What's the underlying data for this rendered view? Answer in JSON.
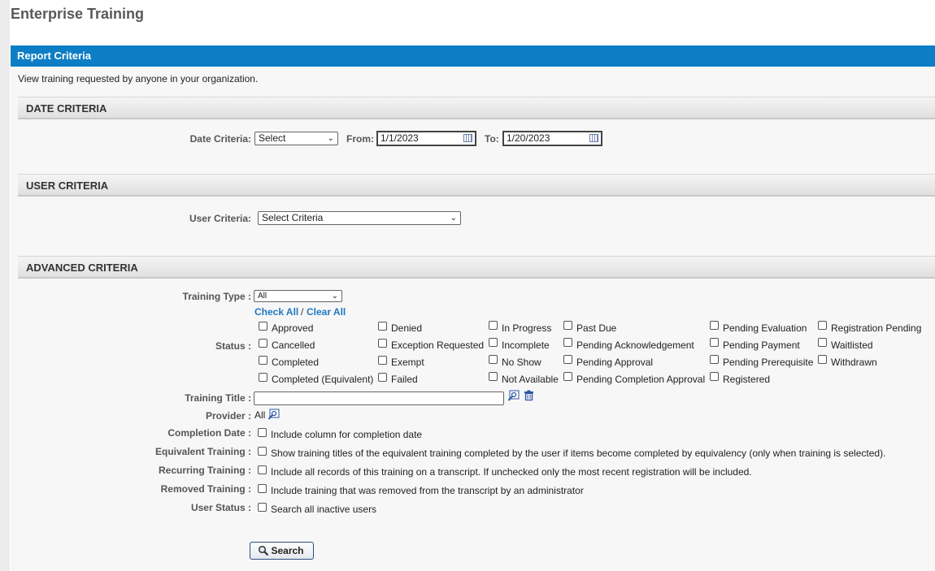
{
  "page_title": "Enterprise Training",
  "panel": {
    "title": "Report Criteria",
    "description": "View training requested by anyone in your organization."
  },
  "date_section": {
    "title": "DATE CRITERIA",
    "date_criteria_label": "Date Criteria:",
    "date_criteria_value": "Select",
    "from_label": "From:",
    "from_value": "1/1/2023",
    "to_label": "To:",
    "to_value": "1/20/2023"
  },
  "user_section": {
    "title": "USER CRITERIA",
    "user_criteria_label": "User Criteria:",
    "user_criteria_value": "Select Criteria"
  },
  "advanced_section": {
    "title": "ADVANCED CRITERIA",
    "training_type_label": "Training Type :",
    "training_type_value": "All",
    "check_all": "Check All",
    "separator": "/",
    "clear_all": "Clear All",
    "status_label": "Status :",
    "statuses": {
      "approved": "Approved",
      "cancelled": "Cancelled",
      "completed": "Completed",
      "completed_equivalent": "Completed (Equivalent)",
      "denied": "Denied",
      "exception_requested": "Exception Requested",
      "exempt": "Exempt",
      "failed": "Failed",
      "in_progress": "In Progress",
      "incomplete": "Incomplete",
      "no_show": "No Show",
      "not_available": "Not Available",
      "past_due": "Past Due",
      "pending_acknowledgement": "Pending Acknowledgement",
      "pending_approval": "Pending Approval",
      "pending_completion_approval": "Pending Completion Approval",
      "pending_evaluation": "Pending Evaluation",
      "pending_payment": "Pending Payment",
      "pending_prerequisite": "Pending Prerequisite",
      "registered": "Registered",
      "registration_pending": "Registration Pending",
      "waitlisted": "Waitlisted",
      "withdrawn": "Withdrawn"
    },
    "training_title_label": "Training Title :",
    "training_title_value": "",
    "provider_label": "Provider :",
    "provider_value": "All",
    "completion_date_label": "Completion Date :",
    "completion_date_text": "Include column for completion date",
    "equivalent_training_label": "Equivalent Training :",
    "equivalent_training_text": "Show training titles of the equivalent training completed by the user if items become completed by equivalency (only when training is selected).",
    "recurring_training_label": "Recurring Training :",
    "recurring_training_text": "Include all records of this training on a transcript. If unchecked only the most recent registration will be included.",
    "removed_training_label": "Removed Training :",
    "removed_training_text": "Include training that was removed from the transcript by an administrator",
    "user_status_label": "User Status :",
    "user_status_text": "Search all inactive users"
  },
  "search_button": "Search",
  "icons": {
    "calendar": "calendar-icon",
    "search_picker": "search-picker-icon",
    "trash": "trash-icon",
    "magnifier": "magnifier-icon"
  },
  "colors": {
    "header_blue": "#0d7ec5",
    "link_blue": "#1f78c1"
  }
}
